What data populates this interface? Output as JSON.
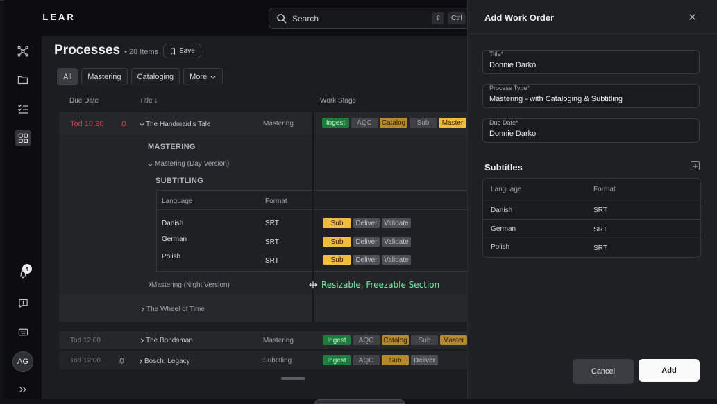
{
  "app": {
    "logo_text": "CLEAR"
  },
  "search": {
    "placeholder": "Search",
    "kbd_shift": "⇧",
    "kbd_ctrl": "Ctrl"
  },
  "sidebar": {
    "items": [
      {
        "icon": "network-icon"
      },
      {
        "icon": "folder-icon"
      },
      {
        "icon": "checklist-icon"
      },
      {
        "icon": "grid-icon",
        "active": true
      }
    ],
    "notifications_count": "4",
    "avatar_initials": "AG"
  },
  "page": {
    "title": "Processes",
    "count": "• 28 Items",
    "save_label": "Save"
  },
  "filters": [
    "All",
    "Mastering",
    "Cataloging",
    "More"
  ],
  "table": {
    "headers": {
      "due_date": "Due Date",
      "title": "Title ↓",
      "work_stage": "Work Stage"
    },
    "row1": {
      "due": "Tod 10:20",
      "title": "The Handmaid's Tale",
      "type": "Mastering",
      "stages": [
        "Ingest",
        "AQC",
        "Catalog",
        "Sub",
        "Master"
      ],
      "section_mastering": "MASTERING",
      "day_version": "Mastering (Day Version)",
      "section_subtitling": "SUBTITLING",
      "nested_headers": {
        "language": "Language",
        "format": "Format"
      },
      "languages": [
        {
          "language": "Danish",
          "format": "SRT",
          "stages": [
            "Sub",
            "Deliver",
            "Validate"
          ]
        },
        {
          "language": "German",
          "format": "SRT",
          "stages": [
            "Sub",
            "Deliver",
            "Validate"
          ]
        },
        {
          "language": "Polish",
          "format": "SRT",
          "stages": [
            "Sub",
            "Deliver",
            "Validate"
          ]
        }
      ],
      "night_version": "Mastering (Night Version)",
      "sub_item": "The Wheel of Time"
    },
    "row2": {
      "due": "Tod 12:00",
      "title": "The Bondsman",
      "type": "Mastering",
      "stages": [
        "Ingest",
        "AQC",
        "Catalog",
        "Sub",
        "Master"
      ]
    },
    "row3": {
      "due": "Tod 12:00",
      "title": "Bosch: Legacy",
      "type": "Subtitling",
      "stages": [
        "Ingest",
        "AQC",
        "Sub",
        "Deliver"
      ]
    }
  },
  "annotation": "Resizable, Freezable Section",
  "drawer": {
    "title": "Add Work Order",
    "fields": {
      "title_label": "Title*",
      "title_value": "Donnie Darko",
      "process_label": "Process Type*",
      "process_value": "Mastering - with Cataloging & Subtitling",
      "due_label": "Due Date*",
      "due_value": "Donnie Darko"
    },
    "subtitles_title": "Subtitles",
    "subtitles_headers": {
      "language": "Language",
      "format": "Format"
    },
    "subtitles": [
      {
        "language": "Danish",
        "format": "SRT"
      },
      {
        "language": "German",
        "format": "SRT"
      },
      {
        "language": "Polish",
        "format": "SRT"
      }
    ],
    "cancel_label": "Cancel",
    "add_label": "Add"
  }
}
